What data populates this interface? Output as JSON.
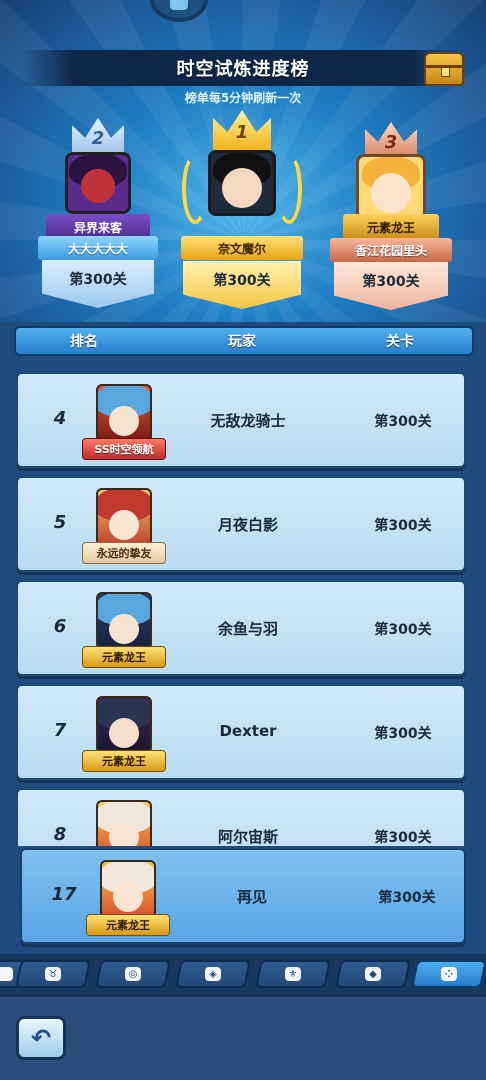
{
  "header": {
    "title": "时空试炼进度榜",
    "subtitle": "榜单每5分钟刷新一次"
  },
  "podium": [
    {
      "rank": "2",
      "badge": "异界来客",
      "name": "大大大大大",
      "level": "第300关",
      "colors": {
        "accent": "#3b9be2"
      }
    },
    {
      "rank": "1",
      "badge": "",
      "name": "奈文魔尔",
      "level": "第300关",
      "colors": {
        "accent": "#f4c542"
      }
    },
    {
      "rank": "3",
      "badge": "元素龙王",
      "name": "香江花园里头",
      "level": "第300关",
      "colors": {
        "accent": "#c8674a"
      }
    }
  ],
  "table": {
    "columns": [
      "排名",
      "玩家",
      "关卡"
    ],
    "rows": [
      {
        "rank": "4",
        "tag": "SS时空领航",
        "name": "无敌龙骑士",
        "level": "第300关"
      },
      {
        "rank": "5",
        "tag": "永远的挚友",
        "name": "月夜白影",
        "level": "第300关"
      },
      {
        "rank": "6",
        "tag": "元素龙王",
        "name": "余鱼与羽",
        "level": "第300关"
      },
      {
        "rank": "7",
        "tag": "元素龙王",
        "name": "Dexter",
        "level": "第300关"
      },
      {
        "rank": "8",
        "tag": "",
        "name": "阿尔宙斯",
        "level": "第300关"
      }
    ],
    "self": {
      "rank": "17",
      "tag": "元素龙王",
      "name": "再见",
      "level": "第300关"
    }
  },
  "tabs": [
    {
      "icon": "horned-helmet-icon"
    },
    {
      "icon": "portal-card-icon"
    },
    {
      "icon": "gem-card-icon"
    },
    {
      "icon": "crest-card-icon"
    },
    {
      "icon": "shield-card-icon"
    },
    {
      "icon": "scatter-icon",
      "active": true
    }
  ],
  "footer": {
    "back_icon": "back-arrow-icon"
  }
}
